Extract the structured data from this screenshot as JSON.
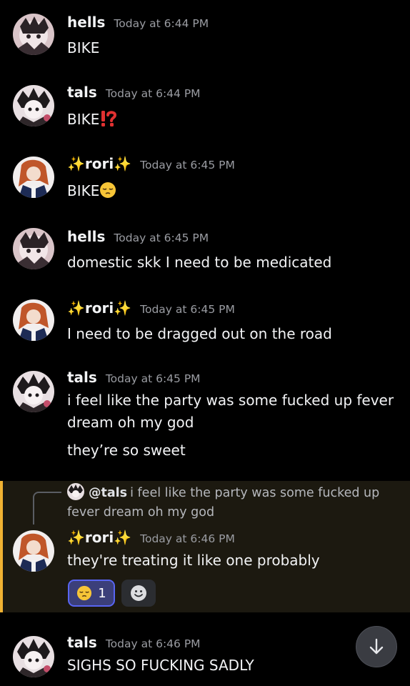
{
  "messages": [
    {
      "author": "hells",
      "timestamp": "Today at 6:44 PM",
      "text": "BIKE"
    },
    {
      "author": "tals",
      "timestamp": "Today at 6:44 PM",
      "text": "BIKE",
      "emoji": "interrobang"
    },
    {
      "author": "rori",
      "timestamp": "Today at 6:45 PM",
      "text": "BIKE",
      "emoji": "pensive-face"
    },
    {
      "author": "hells",
      "timestamp": "Today at 6:45 PM",
      "text": "domestic skk I need to be medicated"
    },
    {
      "author": "rori",
      "timestamp": "Today at 6:45 PM",
      "text": "I need to be dragged out on the road"
    },
    {
      "author": "tals",
      "timestamp": "Today at 6:45 PM",
      "text": "i feel like the party was some fucked up fever dream oh my god",
      "text2": "they’re so sweet"
    },
    {
      "author": "rori",
      "timestamp": "Today at 6:46 PM",
      "text": "they're treating it like one probably",
      "reply": {
        "author": "@tals",
        "text": "i feel like the party was some fucked up fever dream oh my god"
      },
      "reactions": [
        {
          "emoji": "pensive-face",
          "count": "1"
        }
      ]
    },
    {
      "author": "tals",
      "timestamp": "Today at 6:46 PM",
      "text": "SIGHS SO FUCKING SADLY"
    }
  ],
  "colors": {
    "background": "#000000",
    "highlight_bg": "#1c1910",
    "highlight_bar": "#f0b232",
    "reaction_border": "#5865f2",
    "timestamp": "#9a9ca2"
  },
  "icons": {
    "sparkle": "sparkles-icon",
    "add_reaction": "smiley-icon",
    "scroll": "arrow-down-icon"
  }
}
